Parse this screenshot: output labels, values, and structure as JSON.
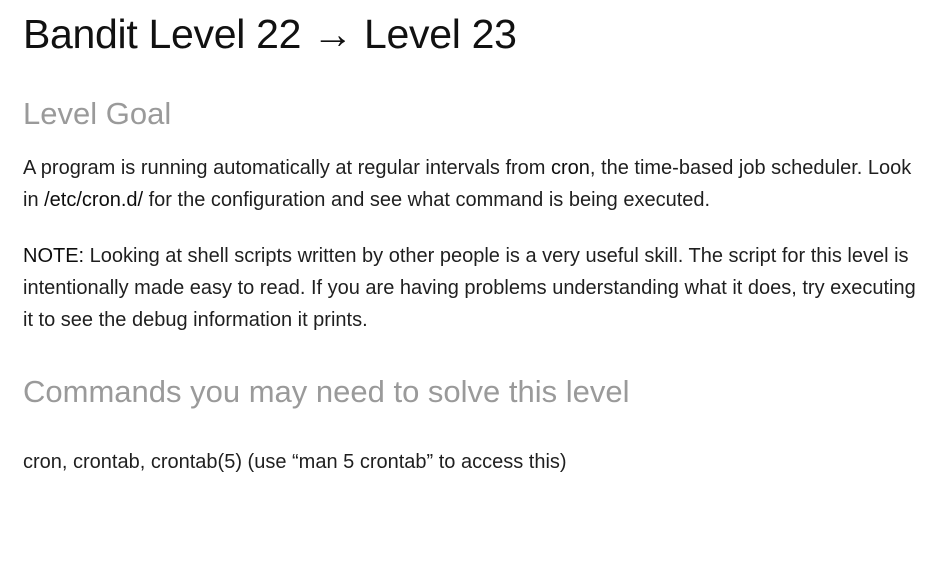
{
  "title": "Bandit Level 22 → Level 23",
  "goal": {
    "heading": "Level Goal",
    "p1": {
      "t1": "A program is running automatically at regular intervals from ",
      "cron": "cron",
      "t2": ", the time-based job scheduler. Look in ",
      "path": "/etc/cron.d/",
      "t3": " for the configuration and see what command is being executed."
    },
    "p2": {
      "label": "NOTE:",
      "text": " Looking at shell scripts written by other people is a very useful skill. The script for this level is intentionally made easy to read. If you are having problems understanding what it does, try executing it to see the debug information it prints."
    }
  },
  "commands": {
    "heading": "Commands you may need to solve this level",
    "text": "cron, crontab, crontab(5) (use “man 5 crontab” to access this)"
  }
}
